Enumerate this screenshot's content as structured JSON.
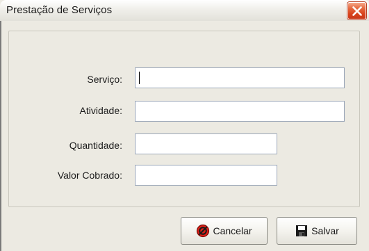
{
  "window": {
    "title": "Prestação de Serviços",
    "close_icon": "close-icon",
    "close_color": "#d8431c"
  },
  "form": {
    "servico": {
      "label": "Serviço:",
      "value": ""
    },
    "atividade": {
      "label": "Atividade:",
      "value": ""
    },
    "quantidade": {
      "label": "Quantidade:",
      "value": ""
    },
    "valor_cobrado": {
      "label": "Valor Cobrado:",
      "value": ""
    }
  },
  "buttons": {
    "cancel": {
      "label": "Cancelar",
      "icon": "cancel-icon"
    },
    "save": {
      "label": "Salvar",
      "icon": "floppy-disk-icon"
    }
  }
}
